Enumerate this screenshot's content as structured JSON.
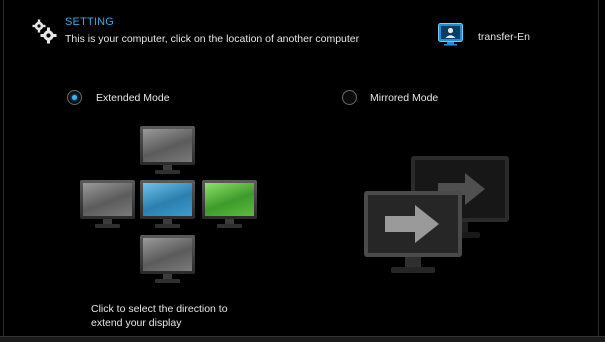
{
  "header": {
    "title": "SETTING",
    "subtitle": "This is your computer, click on the location of another computer",
    "computer_name": "transfer-En"
  },
  "modes": {
    "extended": {
      "label": "Extended Mode",
      "selected": true
    },
    "mirrored": {
      "label": "Mirrored Mode",
      "selected": false
    }
  },
  "hint": {
    "line1": "Click to select the direction to",
    "line2": "extend your display"
  },
  "colors": {
    "accent": "#35a9e8",
    "this_computer_screen": "#2a7fae",
    "other_computer_screen": "#3d9b2b",
    "empty_screen": "#5b5b5b"
  },
  "icons": {
    "settings": "gear-icon",
    "computer": "computer-user-icon"
  }
}
